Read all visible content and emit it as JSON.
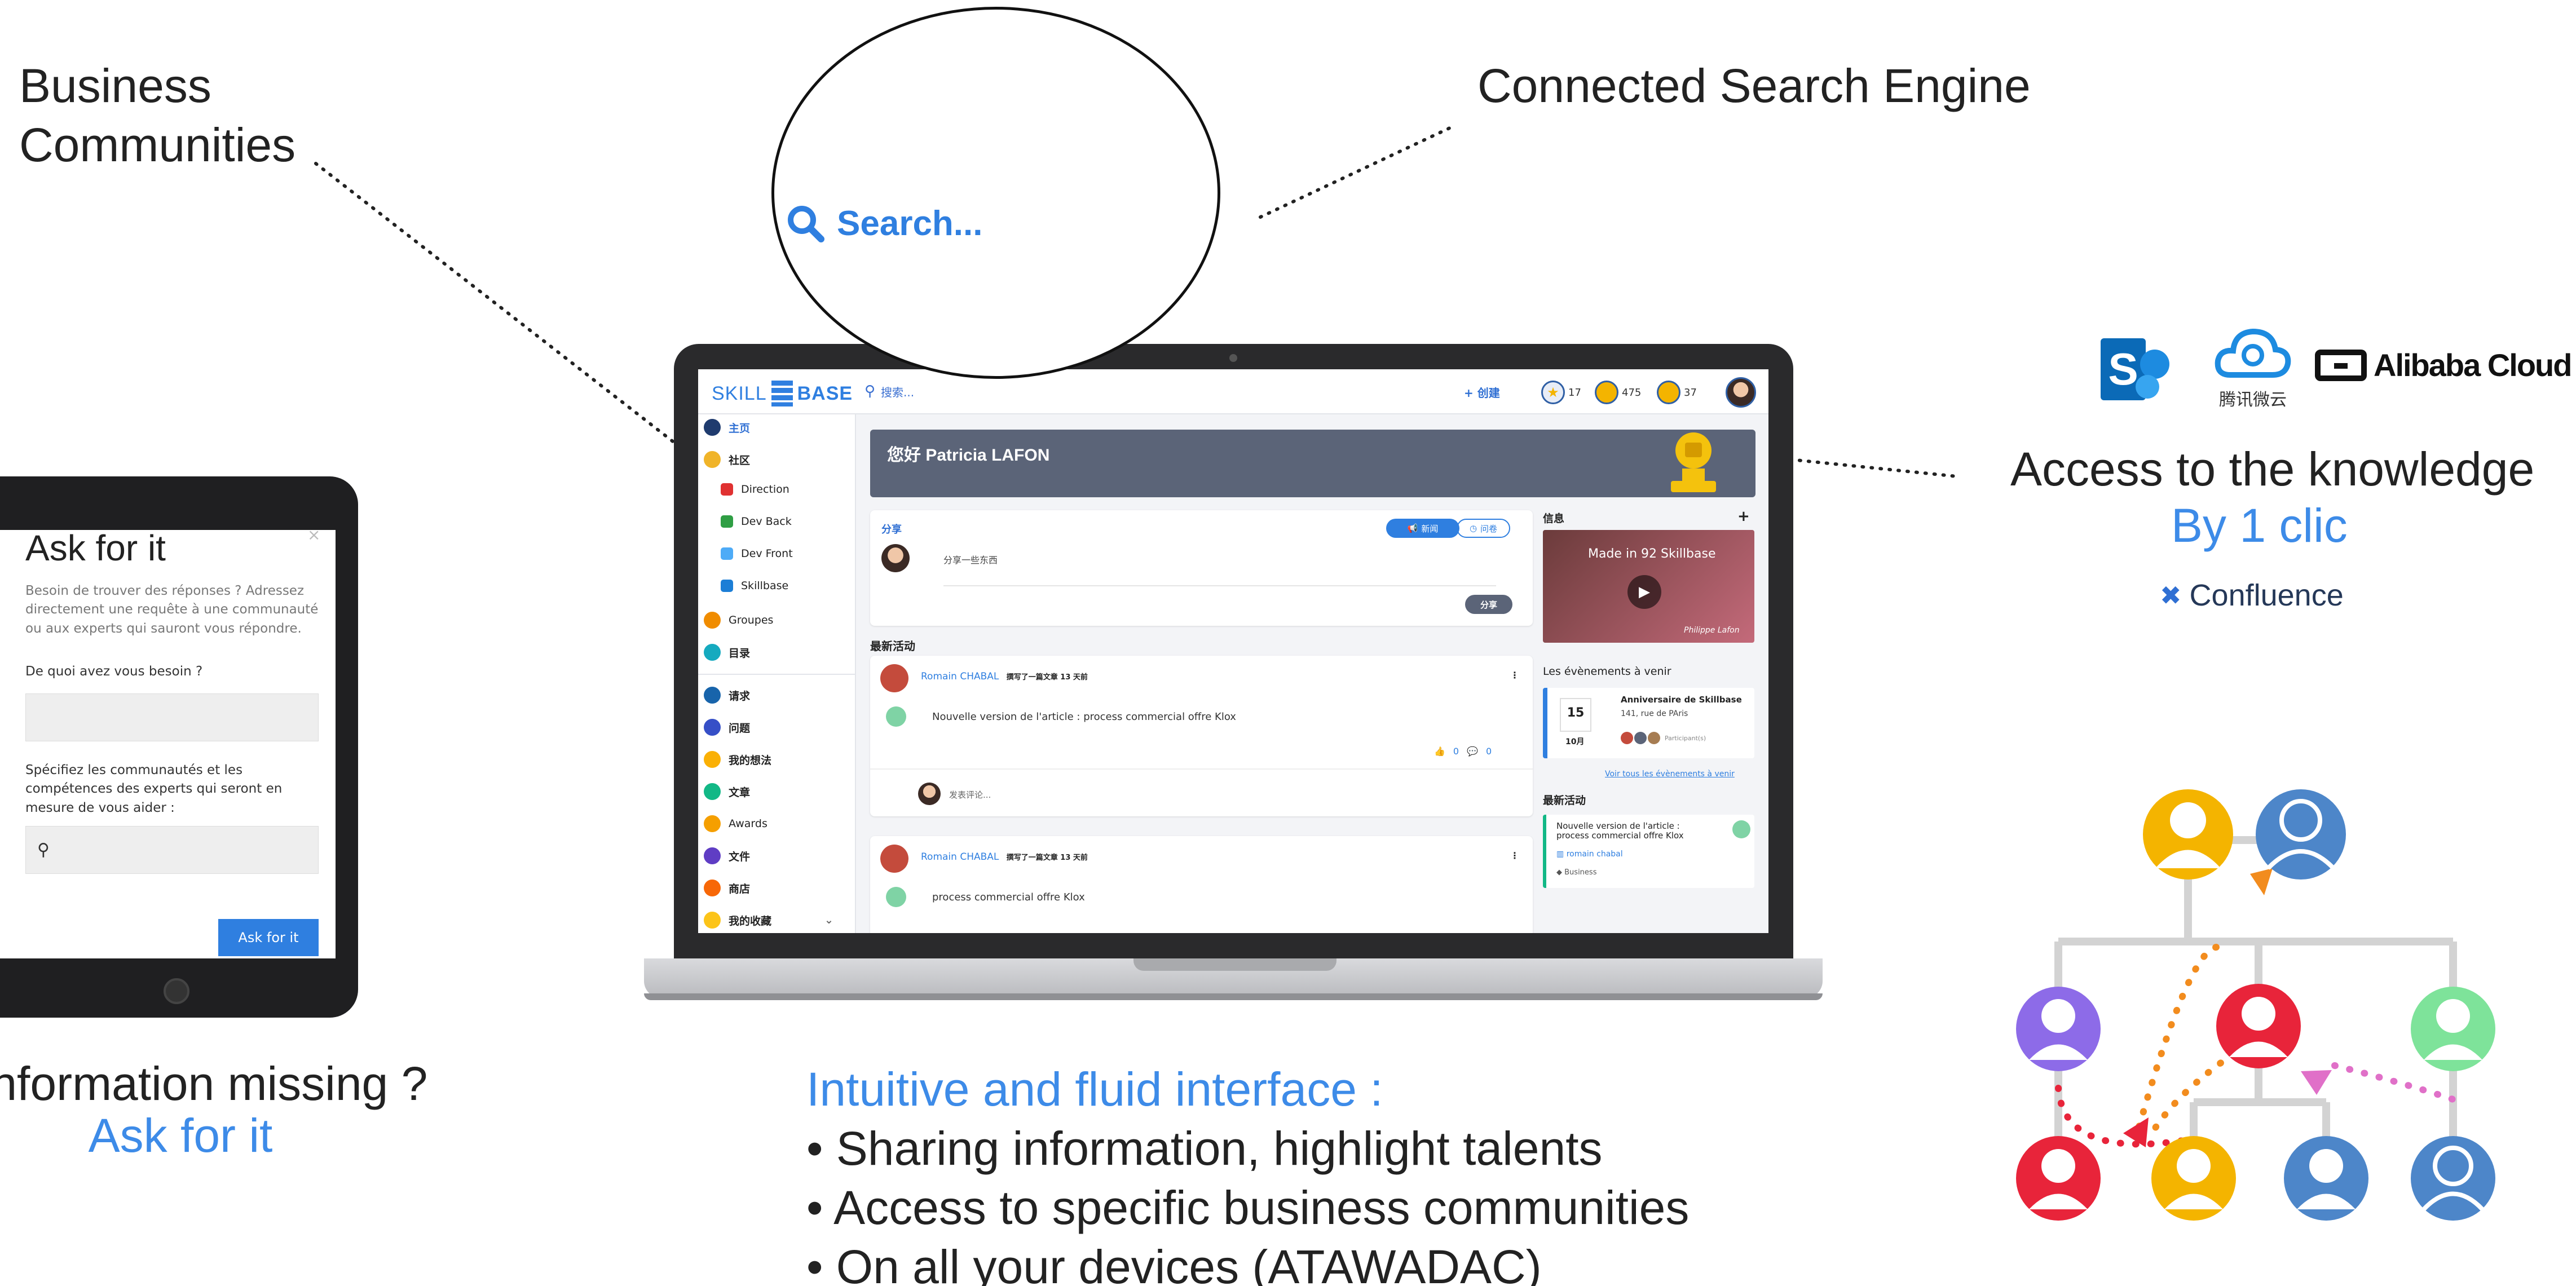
{
  "callouts": {
    "business_communities": [
      "Business",
      "Communities"
    ],
    "connected_search": "Connected Search Engine",
    "access_knowledge": "Access  to the knowledge",
    "by_one_click": "By 1 clic",
    "confluence": "Confluence",
    "information_missing": "Information missing ?",
    "ask_for_it": "Ask for it",
    "intuitive_title": "Intuitive and fluid interface :",
    "bullets": [
      "Sharing information, highlight talents",
      "Access to specific business communities",
      "On all your devices (ATAWADAC)"
    ]
  },
  "search_bubble": {
    "text": "Search..."
  },
  "integrations": {
    "alibaba": "Alibaba Cloud",
    "tencent": "腾讯微云"
  },
  "app": {
    "logo": {
      "left": "SKILL",
      "right": "BASE"
    },
    "search_placeholder": "搜索...",
    "create_label": "+ 创建",
    "badges": {
      "stars": "17",
      "coins": "475",
      "medals": "37"
    },
    "sidebar": {
      "items": [
        {
          "label": "主页",
          "color": "#1f3b6e"
        },
        {
          "label": "社区",
          "color": "#f0b429"
        },
        {
          "label": "Direction",
          "color": "#e03131",
          "letter": "D"
        },
        {
          "label": "Dev Back",
          "color": "#2f9e44",
          "letter": "D"
        },
        {
          "label": "Dev Front",
          "color": "#4dabf7",
          "letter": "D"
        },
        {
          "label": "Skillbase",
          "color": "#1c7ed6",
          "letter": "S"
        },
        {
          "label": "Groupes",
          "color": "#f08c00"
        },
        {
          "label": "目录",
          "color": "#15aabf"
        },
        {
          "label": "请求",
          "color": "#1864ab"
        },
        {
          "label": "问题",
          "color": "#364fc7"
        },
        {
          "label": "我的想法",
          "color": "#fab005"
        },
        {
          "label": "文章",
          "color": "#12b886"
        },
        {
          "label": "Awards",
          "color": "#f59f00"
        },
        {
          "label": "文件",
          "color": "#5f3dc4"
        },
        {
          "label": "商店",
          "color": "#f76707"
        },
        {
          "label": "我的收藏",
          "color": "#fcc419"
        }
      ]
    },
    "banner": {
      "greeting": "您好 Patricia LAFON"
    },
    "share": {
      "title": "分享",
      "placeholder": "分享一些东西",
      "mode_news": "新闻",
      "mode_question": "问卷",
      "submit": "分享"
    },
    "info": {
      "title": "信息",
      "video_title": "Made in 92 Skillbase",
      "video_caption": "Philippe Lafon"
    },
    "events": {
      "title": "Les évènements à venir",
      "day": "15",
      "month": "10月",
      "name": "Anniversaire de Skillbase",
      "address": "141, rue de PAris",
      "participants": "Participant(s)",
      "see_all": "Voir tous les évènements à venir"
    },
    "recent": {
      "title": "最新活动",
      "post1": {
        "author": "Romain CHABAL",
        "action": "撰写了一篇文章 13 天前",
        "text": "Nouvelle version de l'article : process commercial offre Klox",
        "likes": "0",
        "comments": "0",
        "comment_placeholder": "发表评论..."
      },
      "post2": {
        "author": "Romain CHABAL",
        "action": "撰写了一篇文章 13 天前",
        "text": "process commercial offre Klox"
      }
    },
    "side_recent": {
      "title": "最新活动",
      "text": "Nouvelle version de l'article : process commercial offre Klox",
      "author": "romain chabal",
      "tag": "Business"
    }
  },
  "tablet": {
    "title": "Ask for it",
    "intro": "Besoin de trouver des réponses ? Adressez directement une requête à une communauté ou aux experts qui sauront vous répondre.",
    "need_label": "De quoi avez vous besoin ?",
    "specify_label": "Spécifiez les communautés et les compétences des experts qui seront en mesure de vous aider :",
    "button": "Ask for it"
  },
  "colors": {
    "accent": "#3d8be8",
    "banner": "#5b6478",
    "yellow": "#f4b400",
    "red": "#e8243a",
    "purple": "#8d6be8",
    "green": "#7ee39a",
    "blue": "#4d86c9"
  }
}
